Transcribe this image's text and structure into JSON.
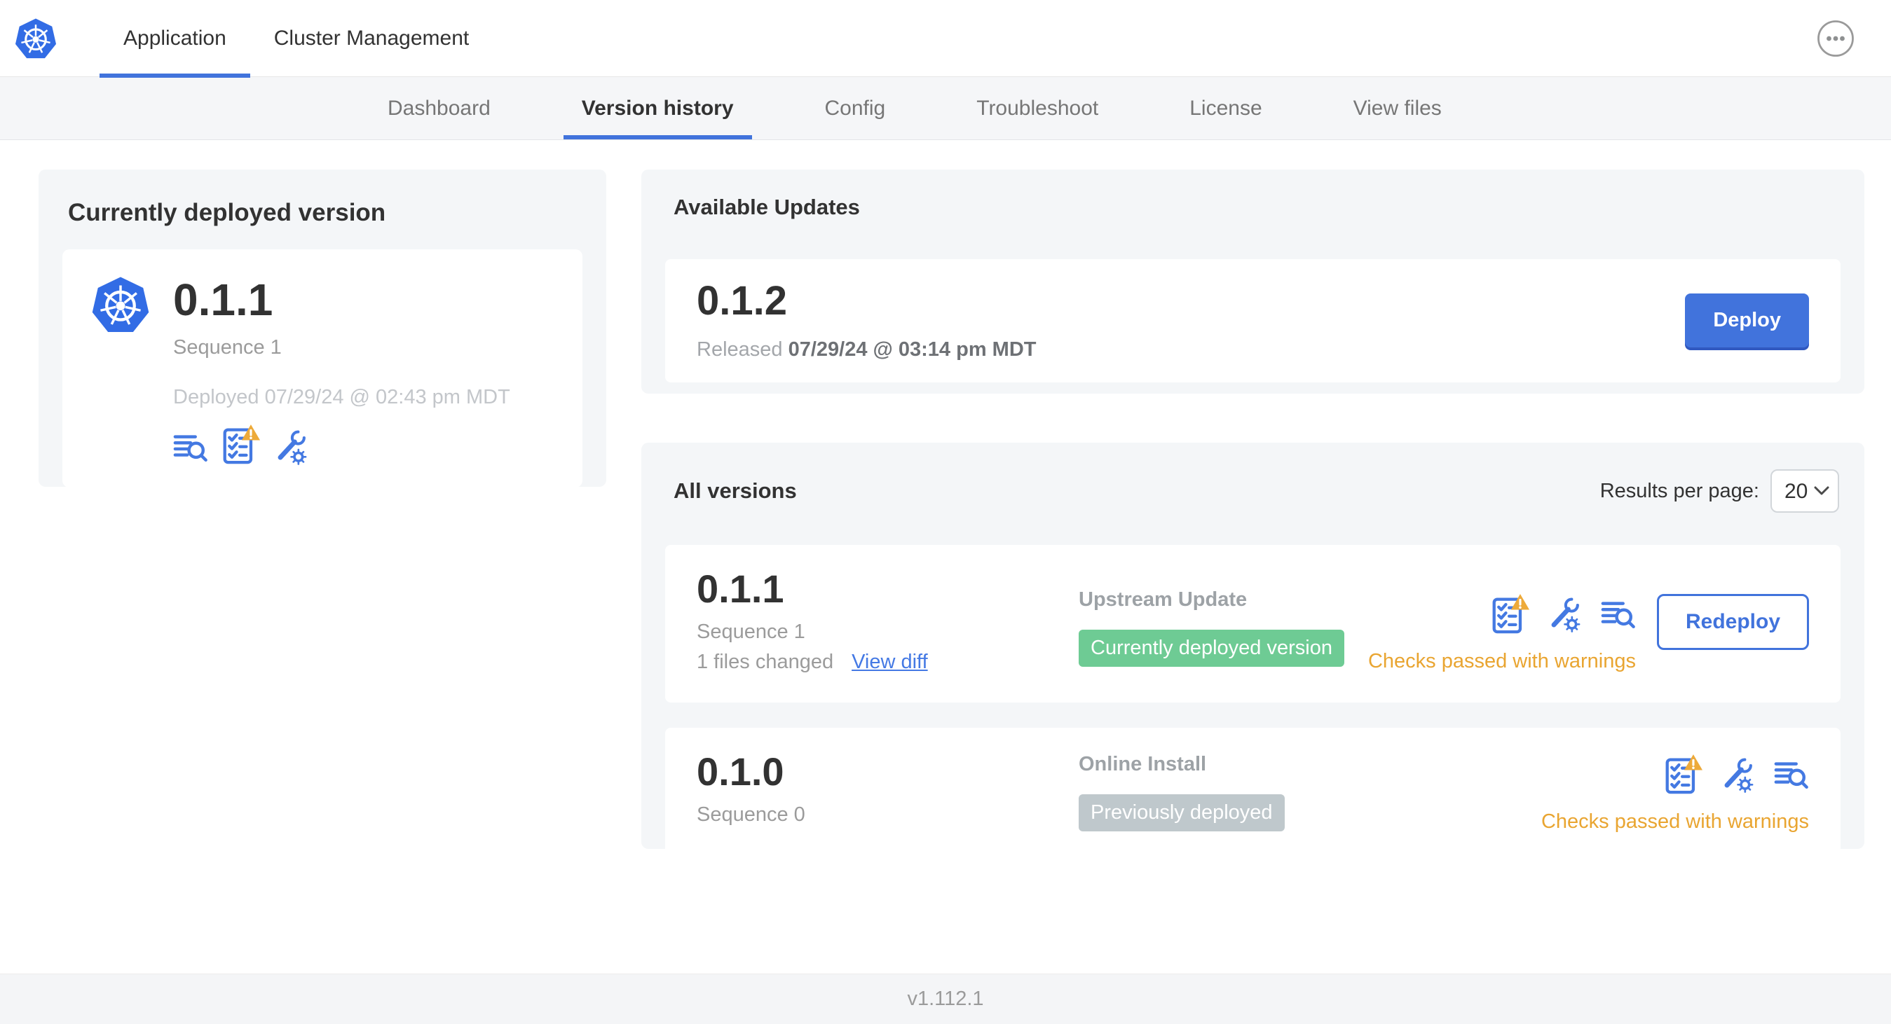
{
  "topnav": {
    "logo_icon": "kubernetes-logo",
    "tabs": [
      {
        "label": "Application",
        "active": true
      },
      {
        "label": "Cluster Management",
        "active": false
      }
    ],
    "menu_icon": "ellipsis-menu"
  },
  "subnav": {
    "tabs": [
      "Dashboard",
      "Version history",
      "Config",
      "Troubleshoot",
      "License",
      "View files"
    ],
    "active_tab": "Version history"
  },
  "deployed_card": {
    "title": "Currently deployed version",
    "version": "0.1.1",
    "sequence": "Sequence 1",
    "deployed_at": "Deployed 07/29/24 @ 02:43 pm MDT",
    "icons": [
      "deploy-logs",
      "preflight-checks-warning",
      "config"
    ]
  },
  "available_updates": {
    "title": "Available Updates",
    "version": "0.1.2",
    "released_label": "Released",
    "released_at": "07/29/24 @ 03:14 pm MDT",
    "deploy_button": "Deploy"
  },
  "all_versions": {
    "title": "All versions",
    "results_per_page_label": "Results per page:",
    "results_per_page_value": "20",
    "rows": [
      {
        "version": "0.1.1",
        "sequence": "Sequence 1",
        "files_changed": "1 files changed",
        "diff_link": "View diff",
        "source": "Upstream Update",
        "badge_label": "Currently deployed version",
        "badge_color": "#6ecb94",
        "status_text": "Checks passed with warnings",
        "action_button": "Redeploy",
        "icons": [
          "preflight-checks-warning",
          "config",
          "deploy-logs"
        ]
      },
      {
        "version": "0.1.0",
        "sequence": "Sequence 0",
        "source": "Online Install",
        "badge_label": "Previously deployed",
        "badge_color": "#bfc8cc",
        "status_text": "Checks passed with warnings",
        "icons": [
          "preflight-checks-warning",
          "config",
          "deploy-logs"
        ]
      }
    ]
  },
  "footer": {
    "version_label": "v1.112.1"
  },
  "colors": {
    "primary_blue": "#4173dc",
    "link_blue": "#4479e4",
    "icon_blue": "#4479e2",
    "k8s_blue": "#326ce5",
    "warning_amber": "#e9a531",
    "badge_green": "#6ecb94",
    "badge_gray": "#bfc8cc"
  }
}
